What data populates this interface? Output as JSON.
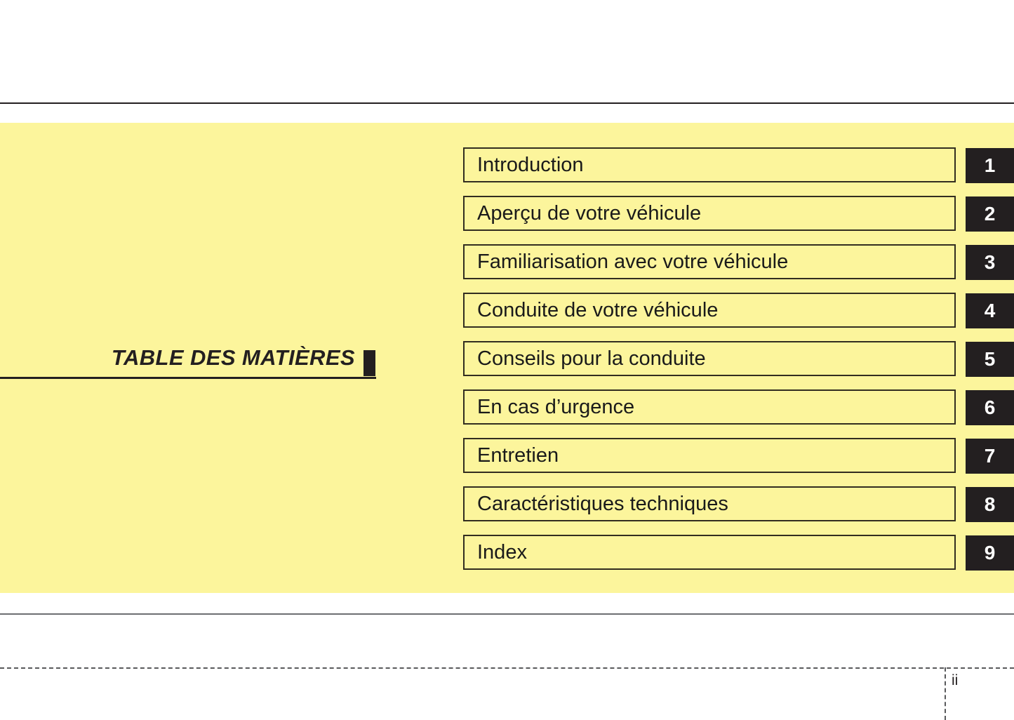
{
  "page": {
    "title": "TABLE DES MATIÈRES",
    "number": "ii",
    "accent_yellow": "#fcf59c",
    "ink": "#231f20",
    "rule_gray": "#6d6e71"
  },
  "toc": {
    "items": [
      {
        "label": "Introduction",
        "number": "1"
      },
      {
        "label": "Aperçu de votre véhicule",
        "number": "2"
      },
      {
        "label": "Familiarisation avec votre véhicule",
        "number": "3"
      },
      {
        "label": "Conduite de votre véhicule",
        "number": "4"
      },
      {
        "label": "Conseils pour la conduite",
        "number": "5"
      },
      {
        "label": "En cas d’urgence",
        "number": "6"
      },
      {
        "label": "Entretien",
        "number": "7"
      },
      {
        "label": "Caractéristiques techniques",
        "number": "8"
      },
      {
        "label": "Index",
        "number": "9"
      }
    ]
  }
}
